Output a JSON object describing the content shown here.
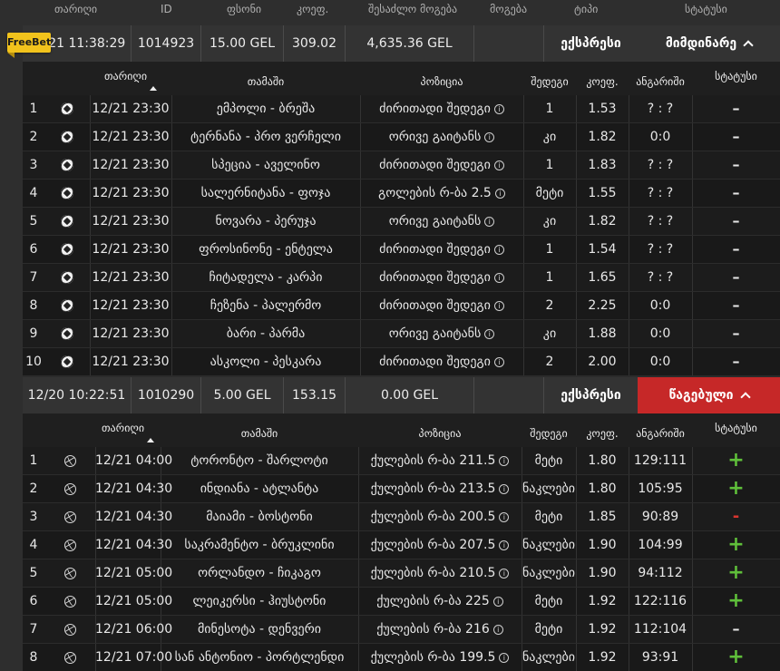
{
  "columns": {
    "date": "თარიღი",
    "id": "ID",
    "stake": "ფსონი",
    "coef": "კოეფ.",
    "possible_win": "შესაძლო მოგება",
    "win": "მოგება",
    "type": "ტიპი",
    "status": "სტატუსი"
  },
  "detail_columns": {
    "date": "თარიღი",
    "game": "თამაში",
    "position": "პოზიცია",
    "result": "შედეგი",
    "coef": "კოეფ.",
    "score": "ანგარიში",
    "status": "სტატუსი"
  },
  "freebet_label": "FreeBet",
  "bets": [
    {
      "date": "12/21 11:38:29",
      "id": "1014923",
      "stake": "15.00 GEL",
      "coef": "309.02",
      "amount": "4,635.36 GEL",
      "type": "ექსპრესი",
      "status": "მიმდინარე",
      "status_color": "#333333",
      "sport_icon": "soccer-ball-icon",
      "rows": [
        {
          "n": "1",
          "date": "12/21 23:30",
          "game": "ემპოლი - ბრეშა",
          "position": "ძირითადი შედეგი",
          "result": "1",
          "coef": "1.53",
          "score": "? : ?",
          "status": "–"
        },
        {
          "n": "2",
          "date": "12/21 23:30",
          "game": "ტერნანა - პრო ვერჩელი",
          "position": "ორივე გაიტანს",
          "result": "კი",
          "coef": "1.82",
          "score": "0:0",
          "status": "–"
        },
        {
          "n": "3",
          "date": "12/21 23:30",
          "game": "სპეცია - აველინო",
          "position": "ძირითადი შედეგი",
          "result": "1",
          "coef": "1.83",
          "score": "? : ?",
          "status": "–"
        },
        {
          "n": "4",
          "date": "12/21 23:30",
          "game": "სალერნიტანა - ფოჯა",
          "position": "გოლების რ-ბა 2.5",
          "result": "მეტი",
          "coef": "1.55",
          "score": "? : ?",
          "status": "–"
        },
        {
          "n": "5",
          "date": "12/21 23:30",
          "game": "ნოვარა - პერუჯა",
          "position": "ორივე გაიტანს",
          "result": "კი",
          "coef": "1.82",
          "score": "? : ?",
          "status": "–"
        },
        {
          "n": "6",
          "date": "12/21 23:30",
          "game": "ფროსინონე - ენტელა",
          "position": "ძირითადი შედეგი",
          "result": "1",
          "coef": "1.54",
          "score": "? : ?",
          "status": "–"
        },
        {
          "n": "7",
          "date": "12/21 23:30",
          "game": "ჩიტადელა - კარპი",
          "position": "ძირითადი შედეგი",
          "result": "1",
          "coef": "1.65",
          "score": "? : ?",
          "status": "–"
        },
        {
          "n": "8",
          "date": "12/21 23:30",
          "game": "ჩეზენა - პალერმო",
          "position": "ძირითადი შედეგი",
          "result": "2",
          "coef": "2.25",
          "score": "0:0",
          "status": "–"
        },
        {
          "n": "9",
          "date": "12/21 23:30",
          "game": "ბარი - პარმა",
          "position": "ორივე გაიტანს",
          "result": "კი",
          "coef": "1.88",
          "score": "0:0",
          "status": "–"
        },
        {
          "n": "10",
          "date": "12/21 23:30",
          "game": "ასკოლი - პესკარა",
          "position": "ძირითადი შედეგი",
          "result": "2",
          "coef": "2.00",
          "score": "0:0",
          "status": "–"
        }
      ]
    },
    {
      "date": "12/20 10:22:51",
      "id": "1010290",
      "stake": "5.00 GEL",
      "coef": "153.15",
      "amount": "0.00 GEL",
      "type": "ექსპრესი",
      "status": "წაგებული",
      "status_color": "#c62828",
      "sport_icon": "basketball-icon",
      "rows": [
        {
          "n": "1",
          "date": "12/21 04:00",
          "game": "ტორონტო - შარლოტი",
          "position": "ქულების რ-ბა 211.5",
          "result": "მეტი",
          "coef": "1.80",
          "score": "129:111",
          "status": "+"
        },
        {
          "n": "2",
          "date": "12/21 04:30",
          "game": "ინდიანა - ატლანტა",
          "position": "ქულების რ-ბა 213.5",
          "result": "ნაკლები",
          "coef": "1.80",
          "score": "105:95",
          "status": "+"
        },
        {
          "n": "3",
          "date": "12/21 04:30",
          "game": "მაიამი - ბოსტონი",
          "position": "ქულების რ-ბა 200.5",
          "result": "მეტი",
          "coef": "1.85",
          "score": "90:89",
          "status": "-"
        },
        {
          "n": "4",
          "date": "12/21 04:30",
          "game": "საკრამენტო - ბრუკლინი",
          "position": "ქულების რ-ბა 207.5",
          "result": "ნაკლები",
          "coef": "1.90",
          "score": "104:99",
          "status": "+"
        },
        {
          "n": "5",
          "date": "12/21 05:00",
          "game": "ორლანდო - ჩიკაგო",
          "position": "ქულების რ-ბა 210.5",
          "result": "ნაკლები",
          "coef": "1.90",
          "score": "94:112",
          "status": "+"
        },
        {
          "n": "6",
          "date": "12/21 05:00",
          "game": "ლეიკერსი - ჰიუსტონი",
          "position": "ქულების რ-ბა 225",
          "result": "მეტი",
          "coef": "1.92",
          "score": "122:116",
          "status": "+"
        },
        {
          "n": "7",
          "date": "12/21 06:00",
          "game": "მინესოტა - დენვერი",
          "position": "ქულების რ-ბა 216",
          "result": "მეტი",
          "coef": "1.92",
          "score": "112:104",
          "status": "–"
        },
        {
          "n": "8",
          "date": "12/21 07:00",
          "game": "სან ანტონიო - პორტლენდი",
          "position": "ქულების რ-ბა 199.5",
          "result": "ნაკლები",
          "coef": "1.92",
          "score": "93:91",
          "status": "+"
        }
      ]
    }
  ]
}
